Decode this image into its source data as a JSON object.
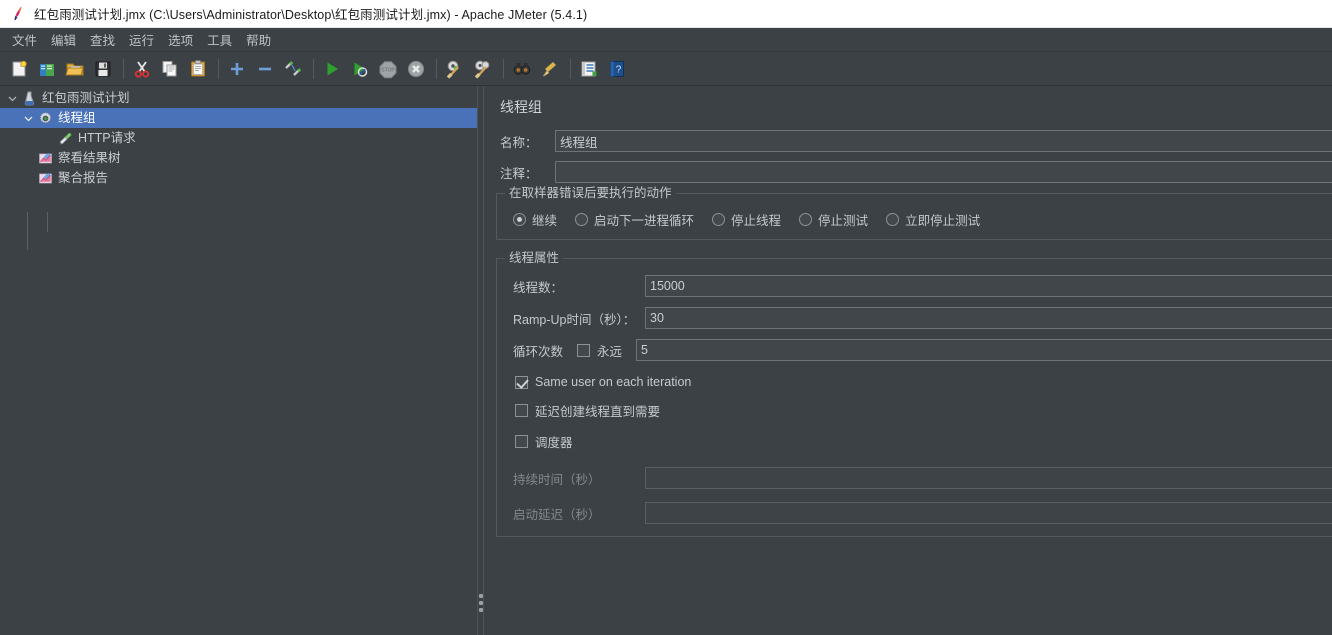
{
  "window": {
    "title": "红包雨测试计划.jmx (C:\\Users\\Administrator\\Desktop\\红包雨测试计划.jmx) - Apache JMeter (5.4.1)",
    "app_icon": "jmeter-feather-icon"
  },
  "menubar": {
    "items": [
      {
        "label": "文件",
        "name": "menu-file"
      },
      {
        "label": "编辑",
        "name": "menu-edit"
      },
      {
        "label": "查找",
        "name": "menu-search"
      },
      {
        "label": "运行",
        "name": "menu-run"
      },
      {
        "label": "选项",
        "name": "menu-options"
      },
      {
        "label": "工具",
        "name": "menu-tools"
      },
      {
        "label": "帮助",
        "name": "menu-help"
      }
    ]
  },
  "toolbar": {
    "buttons": [
      {
        "icon": "new-document-icon",
        "name": "new-test-plan-button"
      },
      {
        "icon": "templates-folder-icon",
        "name": "templates-button"
      },
      {
        "icon": "open-folder-icon",
        "name": "open-button"
      },
      {
        "icon": "save-floppy-icon",
        "name": "save-button"
      },
      {
        "sep": true
      },
      {
        "icon": "cut-scissors-icon",
        "name": "cut-button"
      },
      {
        "icon": "copy-pages-icon",
        "name": "copy-button"
      },
      {
        "icon": "paste-clipboard-icon",
        "name": "paste-button"
      },
      {
        "sep": true
      },
      {
        "icon": "plus-expand-icon",
        "name": "expand-all-button"
      },
      {
        "icon": "minus-collapse-icon",
        "name": "collapse-all-button"
      },
      {
        "icon": "toggle-pencils-icon",
        "name": "toggle-enable-button"
      },
      {
        "sep": true
      },
      {
        "icon": "play-green-icon",
        "name": "start-button"
      },
      {
        "icon": "play-no-pause-icon",
        "name": "start-no-pauses-button"
      },
      {
        "icon": "stop-octagon-icon",
        "name": "stop-button"
      },
      {
        "icon": "shutdown-x-icon",
        "name": "shutdown-button"
      },
      {
        "sep": true
      },
      {
        "icon": "clear-gear-broom-icon",
        "name": "clear-button"
      },
      {
        "icon": "clear-all-broom-icon",
        "name": "clear-all-button"
      },
      {
        "sep": true
      },
      {
        "icon": "binoculars-search-icon",
        "name": "search-button"
      },
      {
        "icon": "broom-reset-icon",
        "name": "reset-search-button"
      },
      {
        "sep": true
      },
      {
        "icon": "function-helper-icon",
        "name": "function-helper-button"
      },
      {
        "icon": "help-question-icon",
        "name": "help-button"
      }
    ]
  },
  "tree": {
    "nodes": [
      {
        "label": "红包雨测试计划",
        "icon": "test-plan-icon",
        "depth": 0,
        "expanded": true,
        "selected": false,
        "name": "tree-node-test-plan"
      },
      {
        "label": "线程组",
        "icon": "thread-group-gear-icon",
        "depth": 1,
        "expanded": true,
        "selected": true,
        "name": "tree-node-thread-group"
      },
      {
        "label": "HTTP请求",
        "icon": "http-sampler-pipette-icon",
        "depth": 2,
        "expanded": null,
        "selected": false,
        "name": "tree-node-http-request"
      },
      {
        "label": "察看结果树",
        "icon": "view-results-tree-icon",
        "depth": 1,
        "expanded": null,
        "selected": false,
        "name": "tree-node-view-results-tree"
      },
      {
        "label": "聚合报告",
        "icon": "aggregate-report-icon",
        "depth": 1,
        "expanded": null,
        "selected": false,
        "name": "tree-node-aggregate-report"
      }
    ]
  },
  "config": {
    "panel_title": "线程组",
    "name_label": "名称：",
    "name_value": "线程组",
    "comment_label": "注释：",
    "comment_value": "",
    "error_action": {
      "legend": "在取样器错误后要执行的动作",
      "options": [
        {
          "label": "继续",
          "selected": true,
          "name": "radio-continue"
        },
        {
          "label": "启动下一进程循环",
          "selected": false,
          "name": "radio-start-next-loop"
        },
        {
          "label": "停止线程",
          "selected": false,
          "name": "radio-stop-thread"
        },
        {
          "label": "停止测试",
          "selected": false,
          "name": "radio-stop-test"
        },
        {
          "label": "立即停止测试",
          "selected": false,
          "name": "radio-stop-test-now"
        }
      ]
    },
    "thread_properties": {
      "legend": "线程属性",
      "threads_label": "线程数：",
      "threads_value": "15000",
      "rampup_label": "Ramp-Up时间（秒）：",
      "rampup_value": "30",
      "loops_label": "循环次数",
      "forever_label": "永远",
      "forever_checked": false,
      "loops_value": "5",
      "same_user_label": "Same user on each iteration",
      "same_user_checked": true,
      "delay_create_label": "延迟创建线程直到需要",
      "delay_create_checked": false,
      "scheduler_label": "调度器",
      "scheduler_checked": false,
      "duration_label": "持续时间（秒）",
      "duration_value": "",
      "duration_enabled": false,
      "startup_delay_label": "启动延迟（秒）",
      "startup_delay_value": "",
      "startup_delay_enabled": false
    }
  },
  "colors": {
    "window_bg": "#3c4145",
    "selection_blue": "#4a72b8",
    "text": "#c4c9cd",
    "field_bg": "#41464a",
    "field_border": "#6d7378",
    "titlebar_bg": "#ffffff"
  }
}
